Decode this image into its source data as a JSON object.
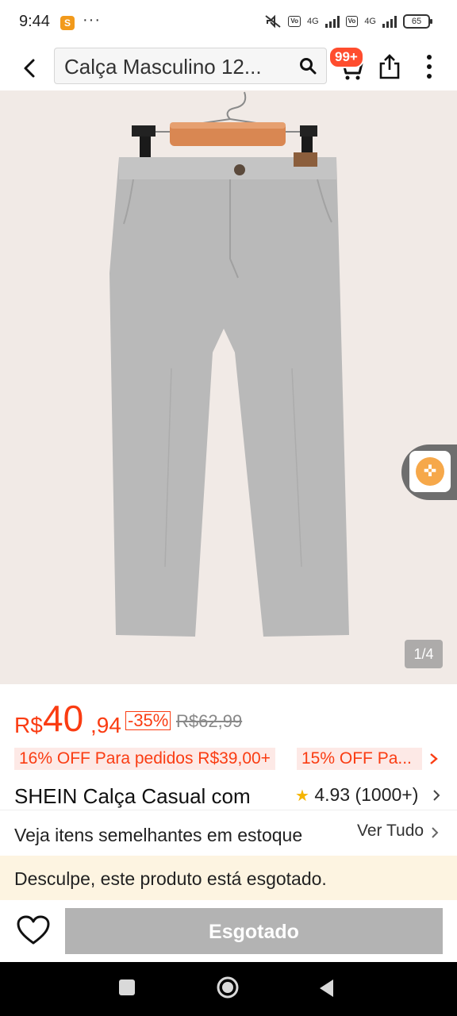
{
  "status_bar": {
    "time": "9:44",
    "app_icon_label": "S",
    "more": "···",
    "network_1": "4G",
    "network_2": "4G",
    "battery": "65"
  },
  "header": {
    "search_text": "Calça Masculino 12...",
    "cart_badge": "99+"
  },
  "gallery": {
    "page_indicator": "1/4"
  },
  "price": {
    "currency": "R$",
    "integer": "40",
    "decimal": ",94",
    "discount": "-35%",
    "original": "R$62,99"
  },
  "promos": [
    "16% OFF Para pedidos R$39,00+",
    "15% OFF Pa..."
  ],
  "product": {
    "title": "SHEIN Calça Casual com",
    "rating": "4.93",
    "rating_count": "(1000+)"
  },
  "similar": {
    "text": "Veja itens semelhantes em estoque",
    "link": "Ver Tudo"
  },
  "soldout": {
    "message": "Desculpe, este produto está esgotado."
  },
  "actions": {
    "button_label": "Esgotado"
  },
  "colors": {
    "price": "#fa3c12",
    "badge": "#ff4d2e",
    "button_disabled": "#b3b3b3",
    "image_bg": "#f1eae6"
  }
}
